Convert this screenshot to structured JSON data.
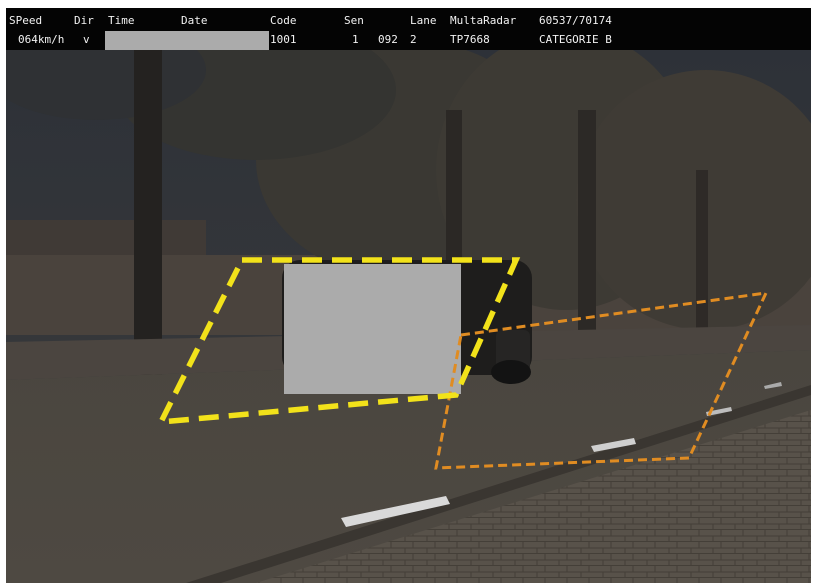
{
  "header": {
    "labels": {
      "speed": "SPeed",
      "dir": "Dir",
      "time": "Time",
      "date": "Date",
      "code": "Code",
      "sen": "Sen",
      "lane": "Lane",
      "device": "MultaRadar",
      "id": "60537/70174"
    },
    "values": {
      "speed": "064km/h",
      "dir": "v",
      "code": "1001",
      "sen": "1",
      "lane_a": "092",
      "lane_b": "2",
      "plate": "TP7668",
      "category": "CATEGORIE B"
    }
  },
  "colors": {
    "header_bg": "#040404",
    "header_text": "#f2f2f2",
    "redaction": "#ababab",
    "zone_primary": "#f2e21a",
    "zone_secondary": "#e08c22"
  }
}
